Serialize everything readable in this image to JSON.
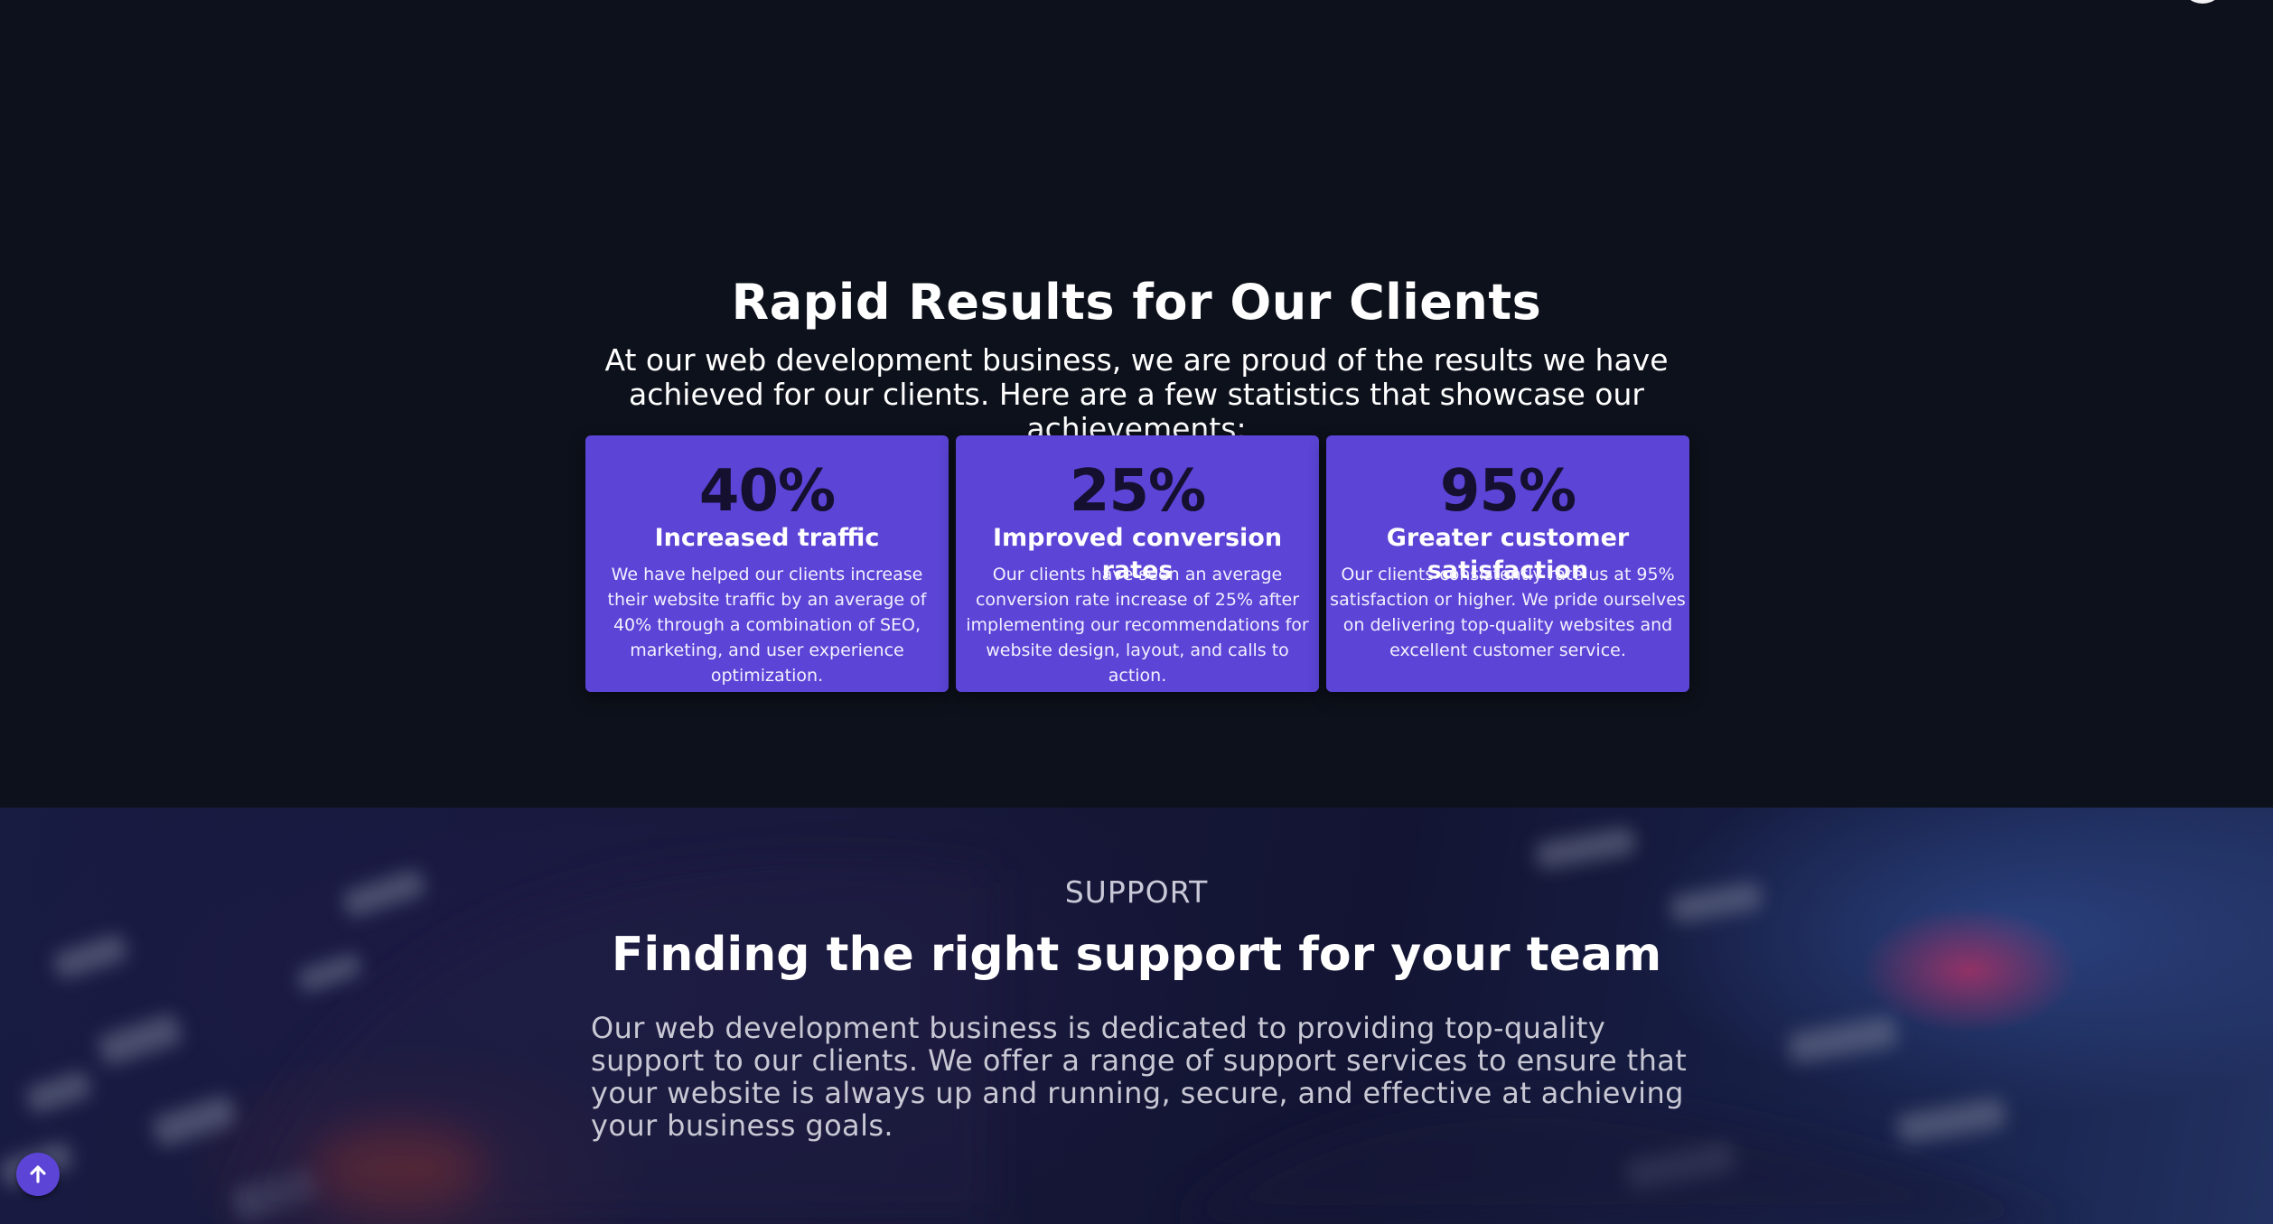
{
  "results": {
    "title": "Rapid Results for Our Clients",
    "intro": "At our web development business, we are proud of the results we have achieved for our clients. Here are a few statistics that showcase our achievements:",
    "cards": [
      {
        "value": "40%",
        "heading": "Increased traffic",
        "text": "We have helped our clients increase their website traffic by an average of 40% through a combination of SEO, marketing, and user experience optimization."
      },
      {
        "value": "25%",
        "heading": "Improved conversion rates",
        "text": "Our clients have seen an average conversion rate increase of 25% after implementing our recommendations for website design, layout, and calls to action."
      },
      {
        "value": "95%",
        "heading": "Greater customer satisfaction",
        "text": "Our clients consistently rate us at 95% satisfaction or higher. We pride ourselves on delivering top-quality websites and excellent customer service."
      }
    ]
  },
  "support": {
    "eyebrow": "SUPPORT",
    "title": "Finding the right support for your team",
    "text": "Our web development business is dedicated to providing top-quality support to our clients. We offer a range of support services to ensure that your website is always up and running, secure, and effective at achieving your business goals."
  },
  "icons": {
    "back_to_top": "arrow-up-icon"
  },
  "colors": {
    "background": "#0d111b",
    "accent": "#5b44d6",
    "stat_value": "#151030"
  }
}
